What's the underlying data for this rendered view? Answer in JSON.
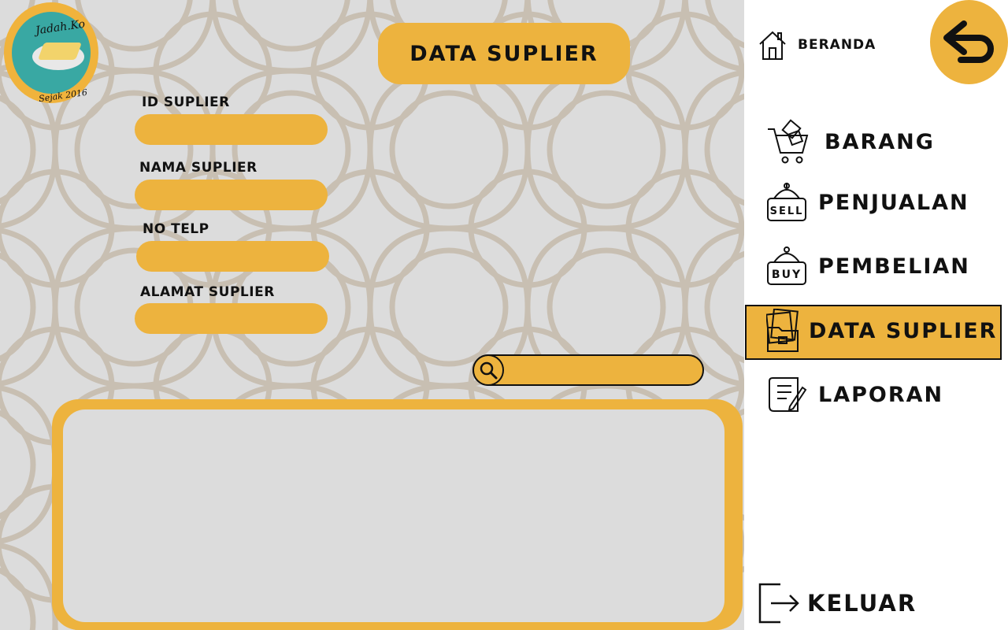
{
  "logo": {
    "name": "Jadah.Ko",
    "tagline": "Sejak 2016"
  },
  "page_title": "DATA SUPLIER",
  "form": {
    "id_label": "ID SUPLIER",
    "id_value": "",
    "nama_label": "NAMA SUPLIER",
    "nama_value": "",
    "telp_label": "NO TELP",
    "telp_value": "",
    "alamat_label": "ALAMAT SUPLIER",
    "alamat_value": ""
  },
  "search": {
    "value": "",
    "icon": "search-icon"
  },
  "table": {
    "rows": []
  },
  "sidebar": {
    "home_label": "BERANDA",
    "back_icon": "back-arrow-icon",
    "items": [
      {
        "label": "BARANG",
        "icon": "cart-icon",
        "active": false
      },
      {
        "label": "PENJUALAN",
        "icon": "sell-tag-icon",
        "active": false
      },
      {
        "label": "PEMBELIAN",
        "icon": "buy-tag-icon",
        "active": false
      },
      {
        "label": "DATA SUPLIER",
        "icon": "folder-icon",
        "active": true
      },
      {
        "label": "LAPORAN",
        "icon": "report-icon",
        "active": false
      }
    ],
    "logout_label": "KELUAR"
  },
  "colors": {
    "accent": "#edb33e",
    "background": "#dcdcdc",
    "pattern": "#c8bfb2",
    "sidebar": "#ffffff",
    "text": "#111111"
  }
}
